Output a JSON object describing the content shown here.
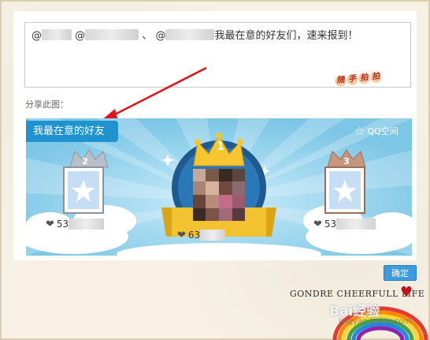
{
  "message": {
    "mention1": "@",
    "mention2": "@",
    "separator": "、",
    "mention3": "@",
    "text": "我最在意的好友们，速来报到！"
  },
  "share_label": "分享此图：",
  "card": {
    "tag": "我最在意的好友",
    "brand": "QQ空间",
    "ranks": [
      {
        "rank": "1",
        "score_prefix": "63"
      },
      {
        "rank": "2",
        "score_prefix": "53"
      },
      {
        "rank": "3",
        "score_prefix": "53"
      }
    ]
  },
  "confirm_label": "确定",
  "footer": {
    "tagline": "GONDRE CHEERFULL LIFE",
    "watermark": "Bai经验",
    "watermark_url": "jingyan.baidu.com"
  },
  "colors": {
    "tag_bg": "#1e93cf",
    "confirm_bg": "#3d9be0",
    "card_bg": "#8fd0ea"
  }
}
